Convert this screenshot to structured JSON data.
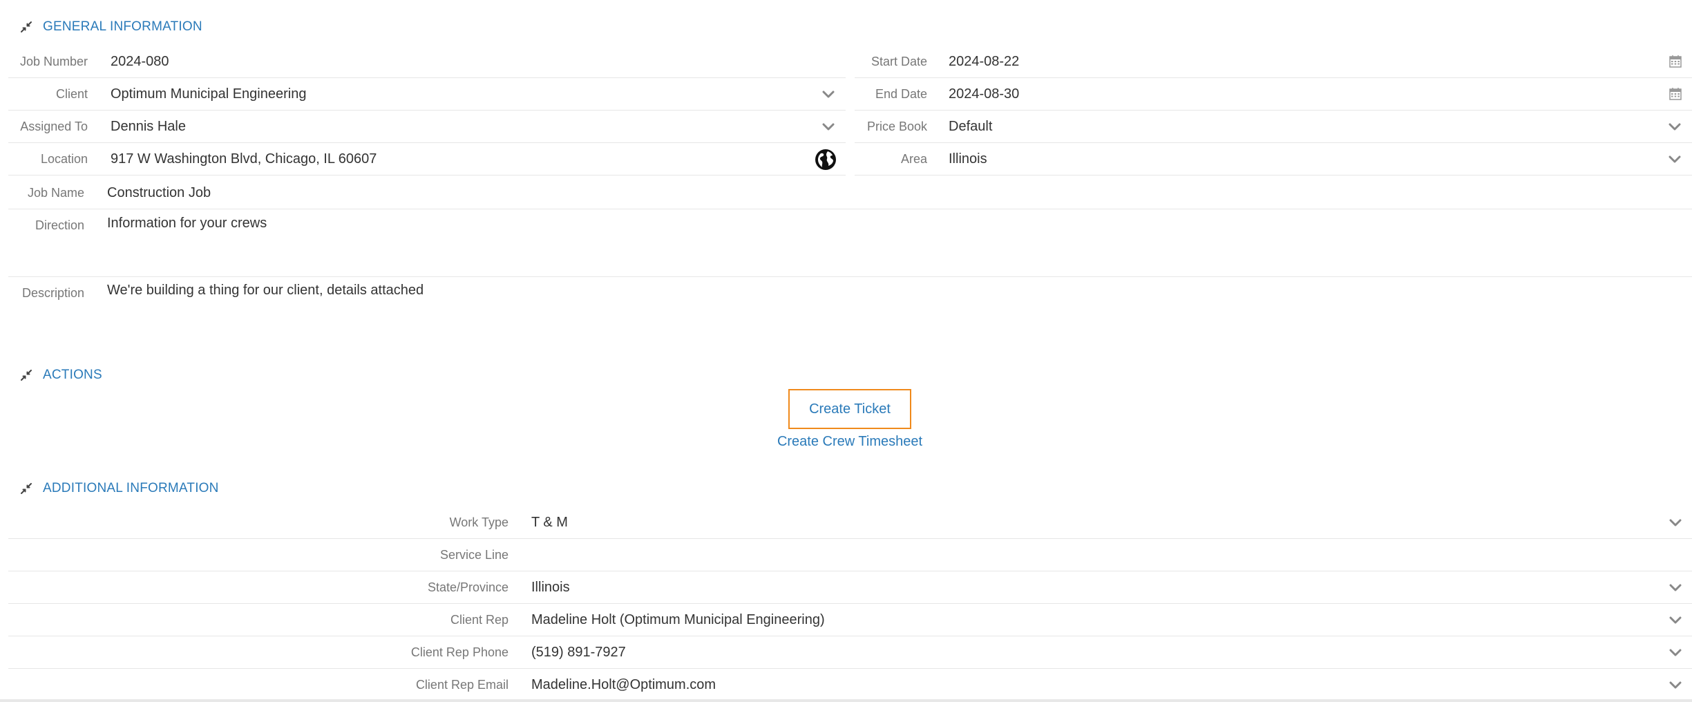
{
  "sections": {
    "general": "GENERAL INFORMATION",
    "actions": "ACTIONS",
    "additional": "ADDITIONAL INFORMATION"
  },
  "general": {
    "job_number": {
      "label": "Job Number",
      "value": "2024-080"
    },
    "client": {
      "label": "Client",
      "value": "Optimum Municipal Engineering"
    },
    "assigned_to": {
      "label": "Assigned To",
      "value": "Dennis Hale"
    },
    "location": {
      "label": "Location",
      "value": "917 W Washington Blvd, Chicago, IL 60607"
    },
    "start_date": {
      "label": "Start Date",
      "value": "2024-08-22"
    },
    "end_date": {
      "label": "End Date",
      "value": "2024-08-30"
    },
    "price_book": {
      "label": "Price Book",
      "value": "Default"
    },
    "area": {
      "label": "Area",
      "value": "Illinois"
    },
    "job_name": {
      "label": "Job Name",
      "value": "Construction Job"
    },
    "direction": {
      "label": "Direction",
      "value": "Information for your crews"
    },
    "description": {
      "label": "Description",
      "value": "We're building a thing for our client, details attached"
    }
  },
  "actions": {
    "create_ticket": "Create Ticket",
    "create_crew_timesheet": "Create Crew Timesheet"
  },
  "additional": {
    "work_type": {
      "label": "Work Type",
      "value": "T & M"
    },
    "service_line": {
      "label": "Service Line",
      "value": ""
    },
    "state_province": {
      "label": "State/Province",
      "value": "Illinois"
    },
    "client_rep": {
      "label": "Client Rep",
      "value": "Madeline Holt (Optimum Municipal Engineering)"
    },
    "client_rep_phone": {
      "label": "Client Rep Phone",
      "value": "(519) 891-7927"
    },
    "client_rep_email": {
      "label": "Client Rep Email",
      "value": "Madeline.Holt@Optimum.com"
    }
  },
  "icons": {
    "collapse": "compress-arrows-icon",
    "dropdown": "chevron-down-icon",
    "calendar": "calendar-icon",
    "globe": "globe-icon"
  },
  "colors": {
    "accent": "#2a7ab9",
    "highlight_border": "#f08a1c",
    "label": "#777777",
    "text": "#333333"
  }
}
